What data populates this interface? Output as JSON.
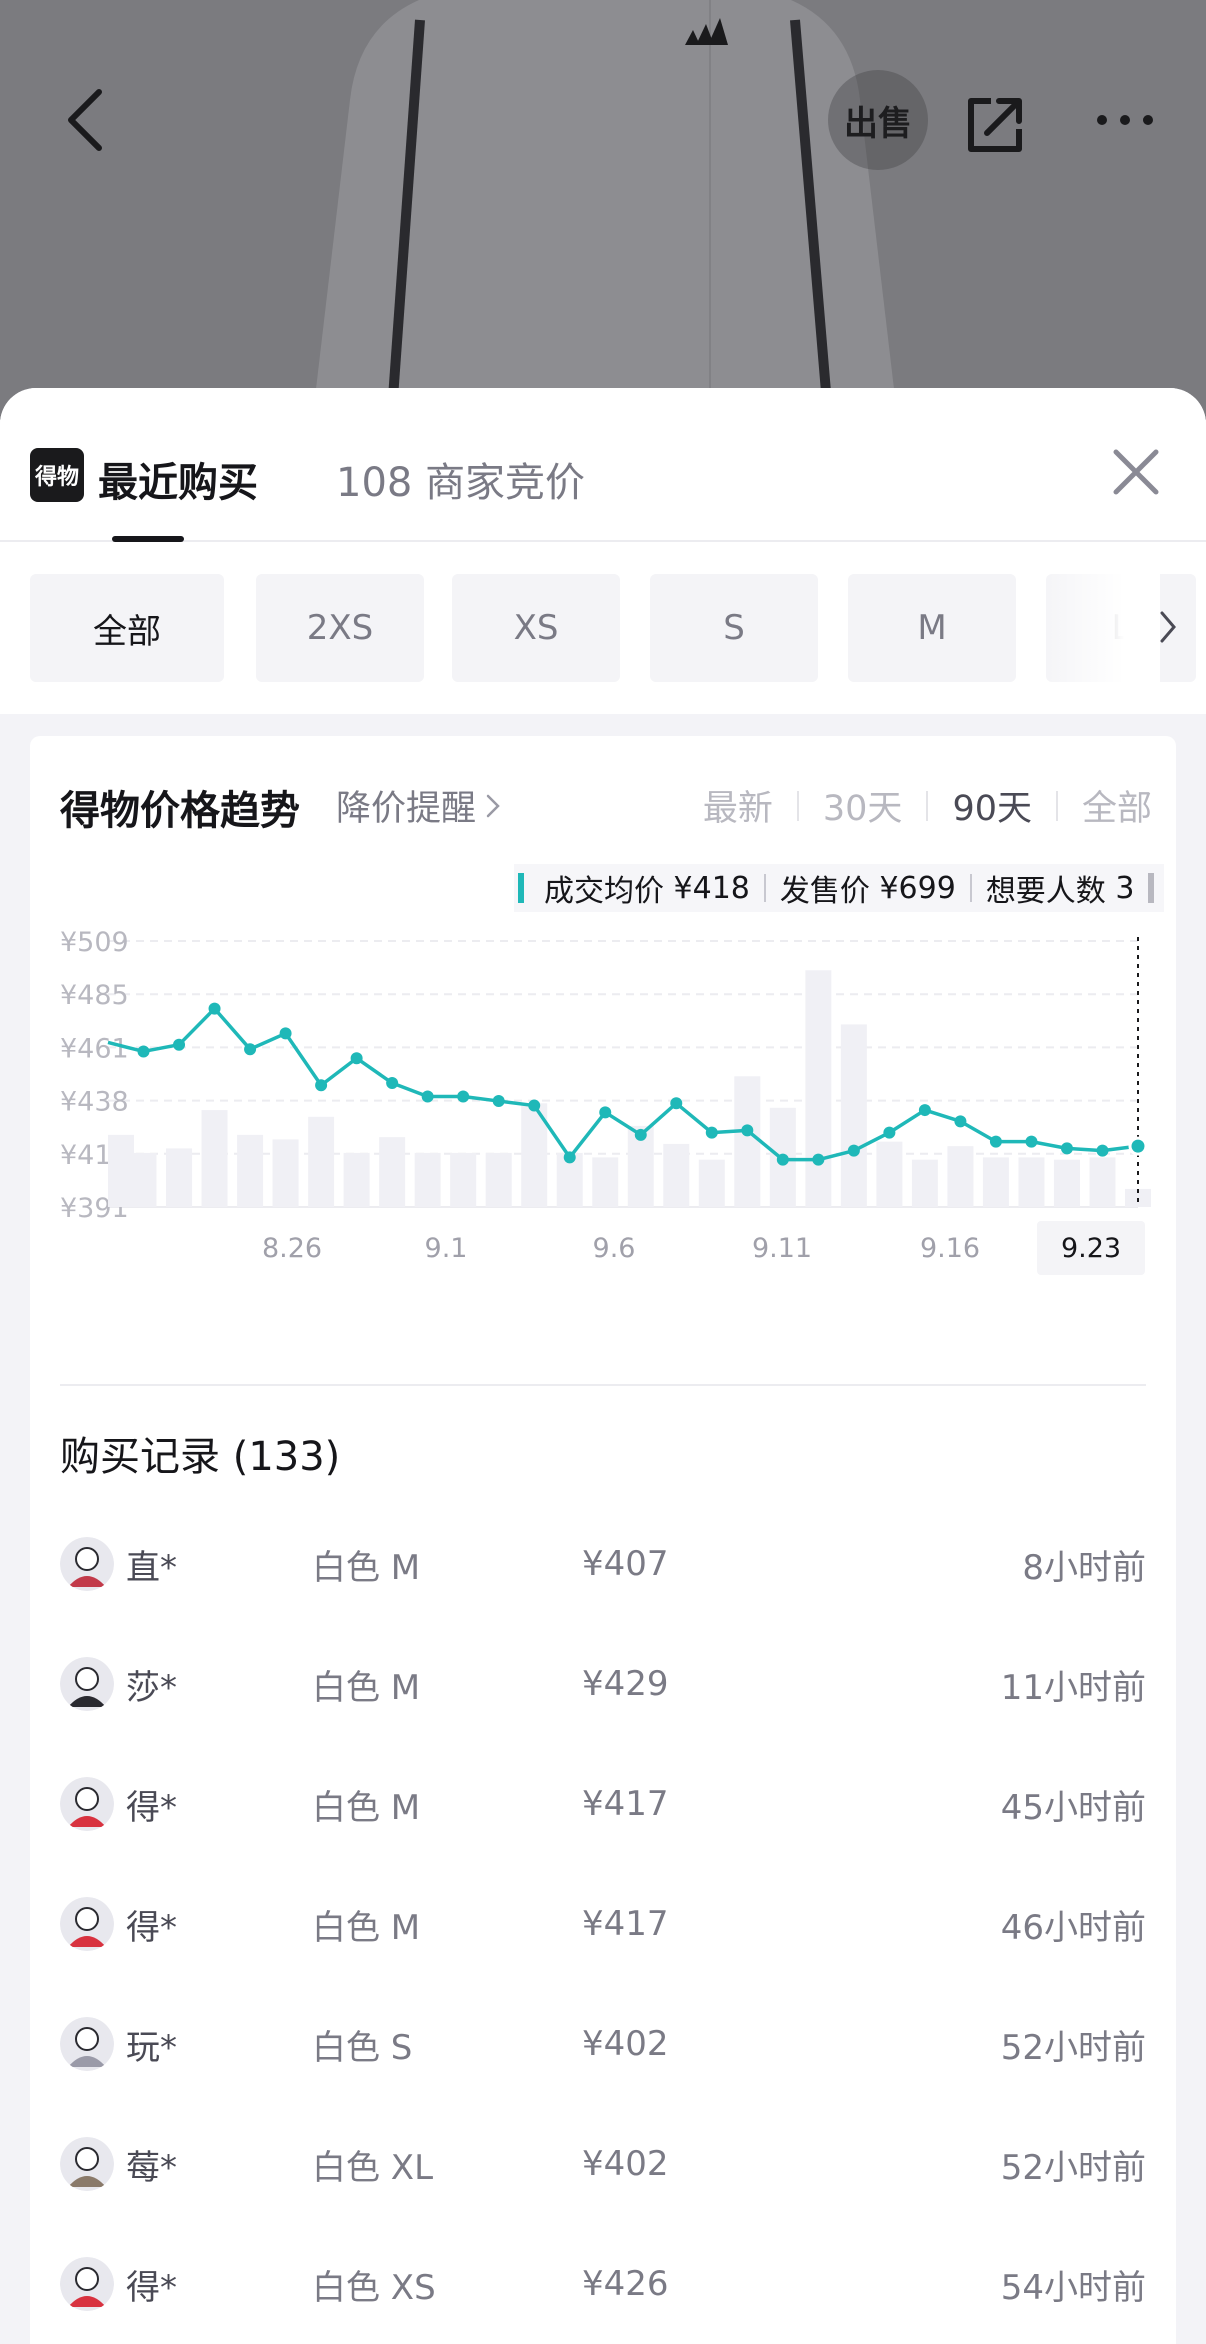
{
  "header": {
    "sell_label": "出售"
  },
  "sheet": {
    "logo_text": "得物",
    "tabs": [
      {
        "label": "最近购买"
      },
      {
        "label": "108 商家竞价"
      }
    ],
    "sizes": [
      {
        "label": "全部",
        "active": true
      },
      {
        "label": "2XS",
        "active": false
      },
      {
        "label": "XS",
        "active": false
      },
      {
        "label": "S",
        "active": false
      },
      {
        "label": "M",
        "active": false
      },
      {
        "label": "L",
        "active": false
      }
    ]
  },
  "trend": {
    "title": "得物价格趋势",
    "alert_label": "降价提醒",
    "ranges": [
      "最新",
      "30天",
      "90天",
      "全部"
    ],
    "active_range": "90天",
    "stats": [
      {
        "label": "成交均价",
        "value": "¥418"
      },
      {
        "label": "发售价",
        "value": "¥699"
      },
      {
        "label": "想要人数",
        "value": "3"
      }
    ]
  },
  "chart_data": {
    "type": "line",
    "y_tick_labels": [
      "¥509",
      "¥485",
      "¥461",
      "¥438",
      "¥414",
      "¥391"
    ],
    "ylim": [
      391,
      509
    ],
    "x_tick_labels": [
      "8.26",
      "9.1",
      "9.6",
      "9.11",
      "9.16",
      "9.23"
    ],
    "selected_x": "9.23",
    "grid": true,
    "series": [
      {
        "type": "line",
        "values": [
          464,
          460,
          463,
          479,
          461,
          468,
          445,
          457,
          446,
          440,
          440,
          438,
          436,
          413,
          433,
          423,
          437,
          424,
          425,
          412,
          412,
          416,
          424,
          434,
          429,
          420,
          420,
          417,
          416,
          418
        ]
      },
      {
        "type": "bar",
        "values": [
          423,
          415,
          417,
          434,
          423,
          421,
          431,
          415,
          422,
          415,
          415,
          415,
          437,
          415,
          413,
          427,
          419,
          412,
          449,
          435,
          496,
          472,
          420,
          412,
          418,
          413,
          413,
          412,
          413,
          399
        ]
      }
    ]
  },
  "records": {
    "title": "购买记录 (133)",
    "rows": [
      {
        "name": "直*",
        "variant": "白色 M",
        "price": "¥407",
        "time": "8小时前",
        "avatar_color": "#c23a4a"
      },
      {
        "name": "莎*",
        "variant": "白色 M",
        "price": "¥429",
        "time": "11小时前",
        "avatar_color": "#2a2a30"
      },
      {
        "name": "得*",
        "variant": "白色 M",
        "price": "¥417",
        "time": "45小时前",
        "avatar_color": "#d8323f"
      },
      {
        "name": "得*",
        "variant": "白色 M",
        "price": "¥417",
        "time": "46小时前",
        "avatar_color": "#d8323f"
      },
      {
        "name": "玩*",
        "variant": "白色 S",
        "price": "¥402",
        "time": "52小时前",
        "avatar_color": "#9a9aa8"
      },
      {
        "name": "莓*",
        "variant": "白色 XL",
        "price": "¥402",
        "time": "52小时前",
        "avatar_color": "#8a7a6a"
      },
      {
        "name": "得*",
        "variant": "白色 XS",
        "price": "¥426",
        "time": "54小时前",
        "avatar_color": "#d8323f"
      }
    ]
  },
  "colors": {
    "accent": "#1fb8b8",
    "bar": "#f0f0f5"
  }
}
